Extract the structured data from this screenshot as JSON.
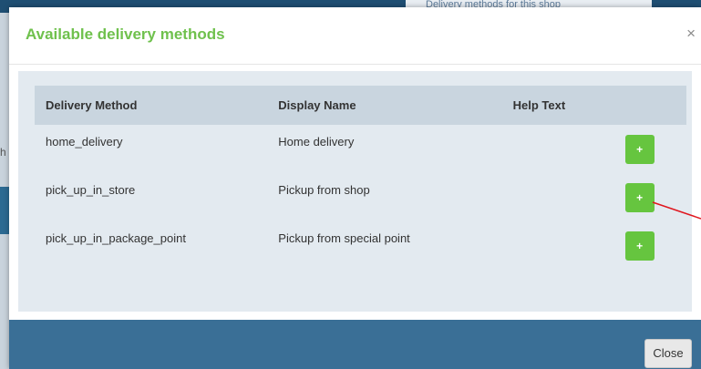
{
  "background": {
    "panel_text": "Delivery methods for this shop",
    "left_char": "h"
  },
  "modal": {
    "title": "Available delivery methods",
    "close_symbol": "×",
    "table": {
      "headers": [
        "Delivery Method",
        "Display Name",
        "Help Text",
        ""
      ],
      "rows": [
        {
          "method": "home_delivery",
          "display": "Home delivery",
          "help": "",
          "action": "+"
        },
        {
          "method": "pick_up_in_store",
          "display": "Pickup from shop",
          "help": "",
          "action": "+"
        },
        {
          "method": "pick_up_in_package_point",
          "display": "Pickup from special point",
          "help": "",
          "action": "+"
        }
      ]
    },
    "footer": {
      "close_label": "Close"
    }
  },
  "colors": {
    "title_green": "#6fc14d",
    "add_button_green": "#66c53f",
    "footer_blue": "#3a6f96",
    "annotation_red": "#e0161e"
  },
  "icons": {
    "add": "plus-icon",
    "close": "close-icon"
  }
}
